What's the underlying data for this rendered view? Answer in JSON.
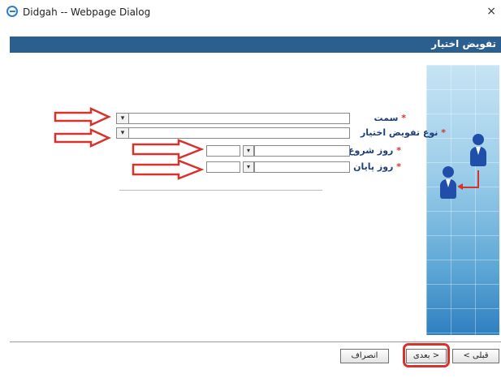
{
  "window": {
    "title": "Didgah -- Webpage Dialog",
    "close_label": "×"
  },
  "dialog": {
    "header_title": "تفویض اختیار"
  },
  "form": {
    "position_label": "سمت",
    "delegation_type_label": "نوع تفویض اختیار",
    "start_day_label": "روز شروع",
    "end_day_label": "روز پایان",
    "required_mark": "*",
    "dropdown_glyph": "▾"
  },
  "buttons": {
    "previous": "< قبلی",
    "next": "بعدی >",
    "cancel": "انصراف"
  },
  "colors": {
    "header_bg": "#2b5f90",
    "label_text": "#1f3f7a",
    "required": "#d8322c",
    "annotation_red": "#d8322c"
  }
}
